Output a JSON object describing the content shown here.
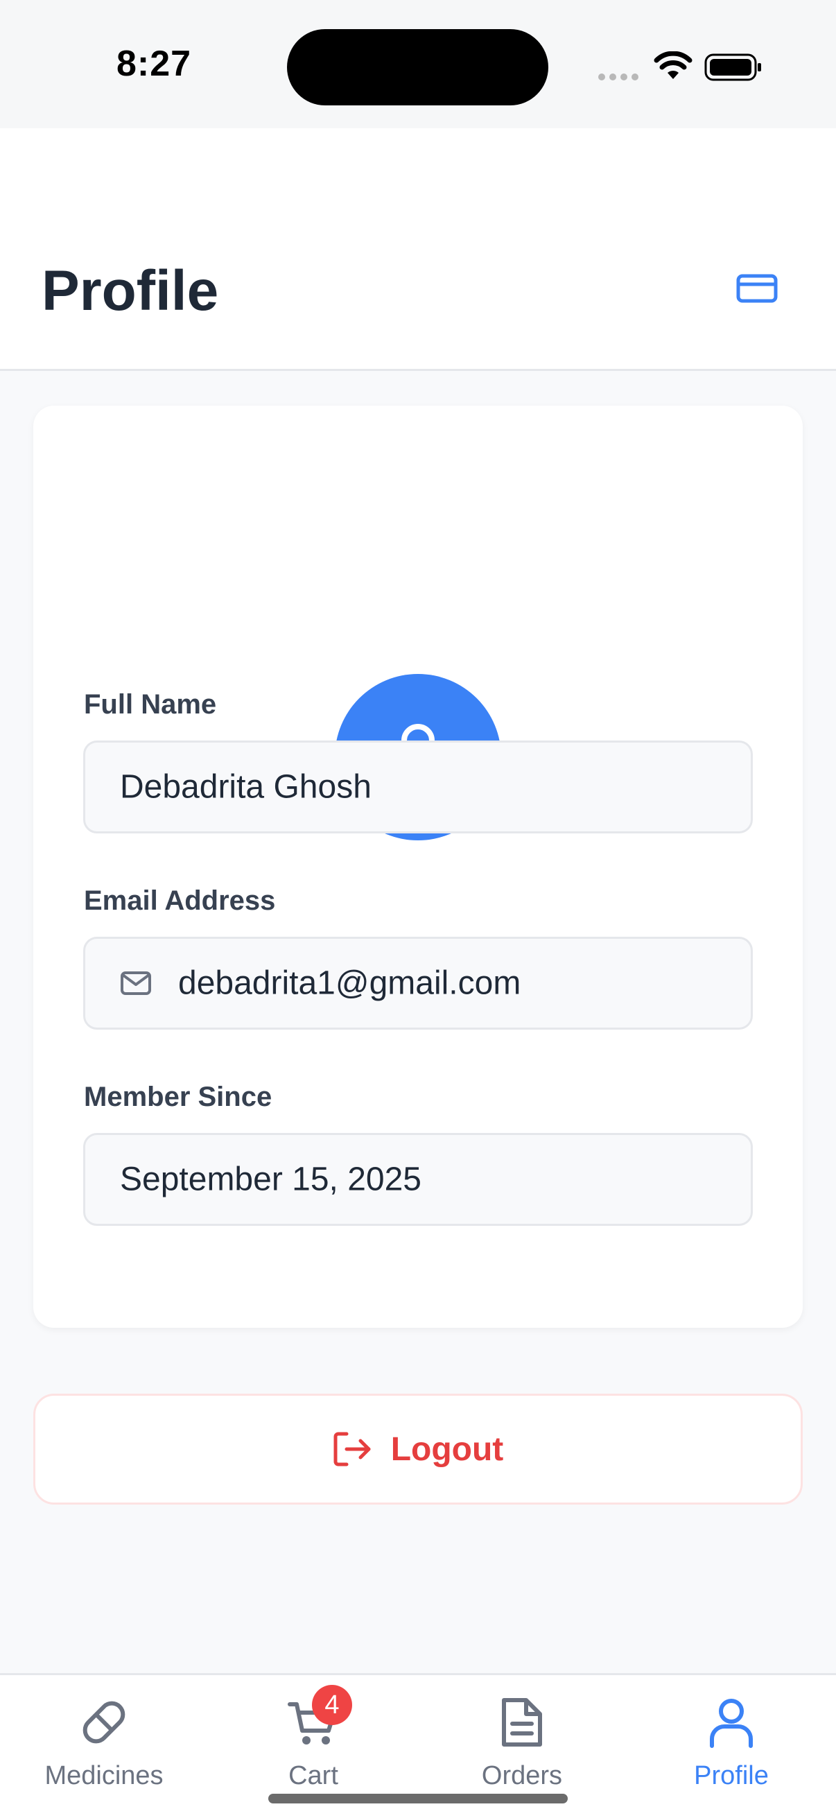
{
  "status_bar": {
    "time": "8:27"
  },
  "header": {
    "title": "Profile",
    "action_icon": "credit-card-icon"
  },
  "profile": {
    "avatar_icon": "user-icon",
    "fields": [
      {
        "label": "Full Name",
        "value": "Debadrita Ghosh"
      },
      {
        "label": "Email Address",
        "value": "debadrita1@gmail.com",
        "icon": "mail-icon"
      },
      {
        "label": "Member Since",
        "value": "September 15, 2025"
      }
    ]
  },
  "logout": {
    "label": "Logout",
    "icon": "logout-icon",
    "color": "#e53e3e"
  },
  "tab_bar": {
    "items": [
      {
        "label": "Medicines",
        "icon": "pill-icon"
      },
      {
        "label": "Cart",
        "icon": "cart-icon",
        "badge": "4"
      },
      {
        "label": "Orders",
        "icon": "document-icon"
      },
      {
        "label": "Profile",
        "icon": "user-icon",
        "active": true
      }
    ],
    "accent": "#3b82f6"
  }
}
